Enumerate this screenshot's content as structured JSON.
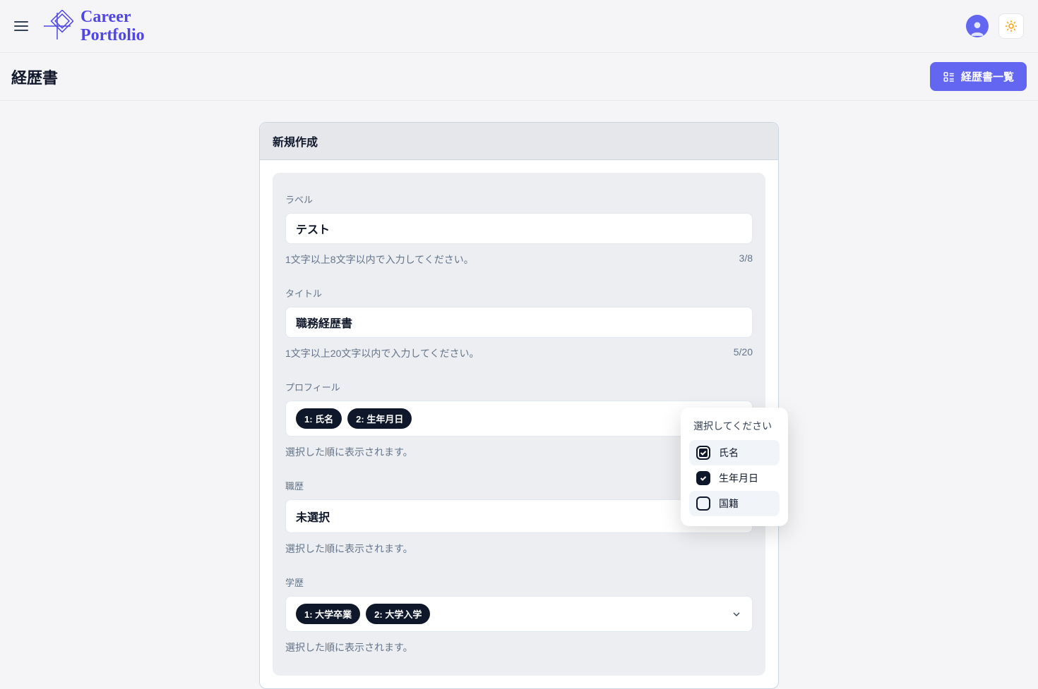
{
  "header": {
    "logo_line1": "Career",
    "logo_line2": "Portfolio"
  },
  "subheader": {
    "title": "経歴書",
    "list_button": "経歴書一覧"
  },
  "card": {
    "title": "新規作成"
  },
  "fields": {
    "label": {
      "label": "ラベル",
      "value": "テスト",
      "helper": "1文字以上8文字以内で入力してください。",
      "counter": "3/8"
    },
    "title": {
      "label": "タイトル",
      "value": "職務経歴書",
      "helper": "1文字以上20文字以内で入力してください。",
      "counter": "5/20"
    },
    "profile": {
      "label": "プロフィール",
      "chip1": "1: 氏名",
      "chip2": "2: 生年月日",
      "helper": "選択した順に表示されます。"
    },
    "work": {
      "label": "職歴",
      "placeholder": "未選択",
      "helper": "選択した順に表示されます。"
    },
    "education": {
      "label": "学歴",
      "chip1": "1: 大学卒業",
      "chip2": "2: 大学入学",
      "helper": "選択した順に表示されます。"
    }
  },
  "dropdown": {
    "title": "選択してください",
    "option1": "氏名",
    "option2": "生年月日",
    "option3": "国籍"
  }
}
